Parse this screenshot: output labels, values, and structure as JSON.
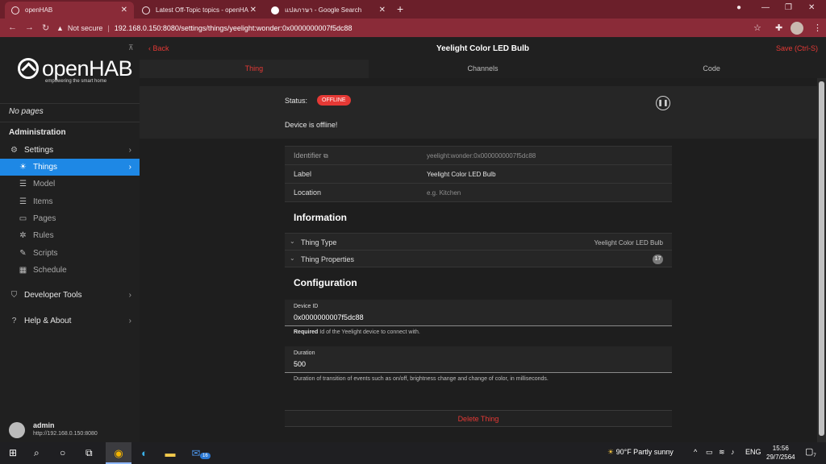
{
  "browser": {
    "tabs": [
      {
        "title": "openHAB",
        "active": true
      },
      {
        "title": "Latest Off-Topic topics - openHA"
      },
      {
        "title": "แปลภาษา - Google Search"
      }
    ],
    "new_tab": "+",
    "address": {
      "not_secure": "Not secure",
      "url": "192.168.0.150:8080/settings/things/yeelight:wonder:0x0000000007f5dc88"
    }
  },
  "sidebar": {
    "logo_word": "openHAB",
    "logo_tag": "empowering the smart home",
    "no_pages": "No pages",
    "admin_heading": "Administration",
    "items": [
      {
        "label": "Settings",
        "icon": "gear-icon"
      },
      {
        "label": "Things",
        "icon": "lightbulb-icon"
      },
      {
        "label": "Model",
        "icon": "list-icon"
      },
      {
        "label": "Items",
        "icon": "list-icon"
      },
      {
        "label": "Pages",
        "icon": "display-icon"
      },
      {
        "label": "Rules",
        "icon": "sparkle-icon"
      },
      {
        "label": "Scripts",
        "icon": "script-icon"
      },
      {
        "label": "Schedule",
        "icon": "calendar-icon"
      },
      {
        "label": "Developer Tools",
        "icon": "shield-icon"
      },
      {
        "label": "Help & About",
        "icon": "question-icon"
      }
    ],
    "user": {
      "name": "admin",
      "address": "http://192.168.0.150:8080"
    }
  },
  "header": {
    "back": "Back",
    "title": "Yeelight Color LED Bulb",
    "save": "Save (Ctrl-S)"
  },
  "tabs": [
    "Thing",
    "Channels",
    "Code"
  ],
  "status": {
    "label": "Status:",
    "value": "OFFLINE",
    "message": "Device is offline!"
  },
  "properties": {
    "identifier_label": "Identifier",
    "identifier_value": "yeelight:wonder:0x0000000007f5dc88",
    "label_label": "Label",
    "label_value": "Yeelight Color LED Bulb",
    "location_label": "Location",
    "location_placeholder": "e.g. Kitchen"
  },
  "information": {
    "heading": "Information",
    "thing_type_label": "Thing Type",
    "thing_type_value": "Yeelight Color LED Bulb",
    "thing_properties_label": "Thing Properties",
    "thing_properties_count": "17"
  },
  "configuration": {
    "heading": "Configuration",
    "device_id_label": "Device ID",
    "device_id_value": "0x0000000007f5dc88",
    "device_id_hint_strong": "Required",
    "device_id_hint": "Id of the Yeelight device to connect with.",
    "duration_label": "Duration",
    "duration_value": "500",
    "duration_hint": "Duration of transition of events such as on/off, brightness change and change of color, in milliseconds."
  },
  "delete": "Delete Thing",
  "taskbar": {
    "weather": "90°F  Partly sunny",
    "lang": "ENG",
    "time": "15:56",
    "date": "29/7/2564",
    "mail_badge": "16",
    "notif_count": "7"
  }
}
